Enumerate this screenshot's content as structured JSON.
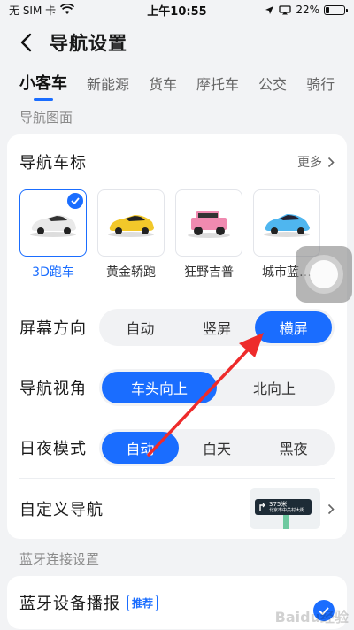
{
  "status": {
    "carrier": "无 SIM 卡",
    "time": "上午10:55",
    "battery": "22%",
    "battery_level": 0.22
  },
  "header": {
    "title": "导航设置"
  },
  "tabs": [
    {
      "label": "小客车",
      "active": true
    },
    {
      "label": "新能源"
    },
    {
      "label": "货车"
    },
    {
      "label": "摩托车"
    },
    {
      "label": "公交"
    },
    {
      "label": "骑行"
    }
  ],
  "sections": {
    "map": "导航图面",
    "bluetooth": "蓝牙连接设置"
  },
  "car_icon": {
    "title": "导航车标",
    "more": "更多",
    "items": [
      {
        "label": "3D跑车",
        "selected": true,
        "color": "#e9e9e9"
      },
      {
        "label": "黄金轿跑",
        "color": "#f2c82a"
      },
      {
        "label": "狂野吉普",
        "color": "#f08ab0"
      },
      {
        "label": "城市蓝…",
        "color": "#4fb6ef"
      }
    ]
  },
  "orientation": {
    "label": "屏幕方向",
    "options": [
      "自动",
      "竖屏",
      "横屏"
    ],
    "selected": "横屏"
  },
  "view_angle": {
    "label": "导航视角",
    "options": [
      "车头向上",
      "北向上"
    ],
    "selected": "车头向上"
  },
  "day_night": {
    "label": "日夜模式",
    "options": [
      "自动",
      "白天",
      "黑夜"
    ],
    "selected": "自动"
  },
  "custom_nav": {
    "label": "自定义导航",
    "preview_text": "375米",
    "preview_sub": "北京市中关村大街"
  },
  "bluetooth_broadcast": {
    "label": "蓝牙设备播报",
    "tag": "推荐"
  },
  "watermark": "Baidu经验"
}
